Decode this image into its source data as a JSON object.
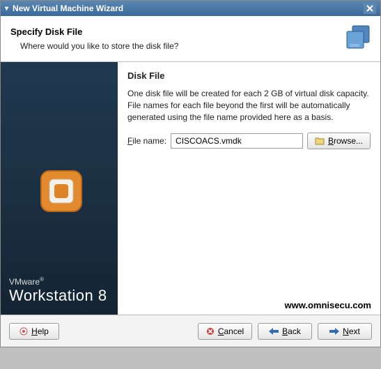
{
  "titlebar": {
    "title": "New Virtual Machine Wizard"
  },
  "header": {
    "title": "Specify Disk File",
    "subtitle": "Where would you like to store the disk file?"
  },
  "content": {
    "section_title": "Disk File",
    "description": "One disk file will be created for each 2 GB of virtual disk capacity. File names for each file beyond the first will be automatically generated using the file name provided here as a basis.",
    "filename_label_prefix": "F",
    "filename_label_rest": "ile name:",
    "filename_value": "CISCOACS.vmdk",
    "browse_label_prefix": "B",
    "browse_label_rest": "rowse..."
  },
  "brand": {
    "line1": "VMware",
    "line2": "Workstation 8"
  },
  "footer": {
    "help_prefix": "H",
    "help_rest": "elp",
    "cancel_prefix": "C",
    "cancel_rest": "ancel",
    "back_prefix": "B",
    "back_rest": "ack",
    "next_prefix": "N",
    "next_rest": "ext"
  },
  "watermark": "www.omnisecu.com"
}
